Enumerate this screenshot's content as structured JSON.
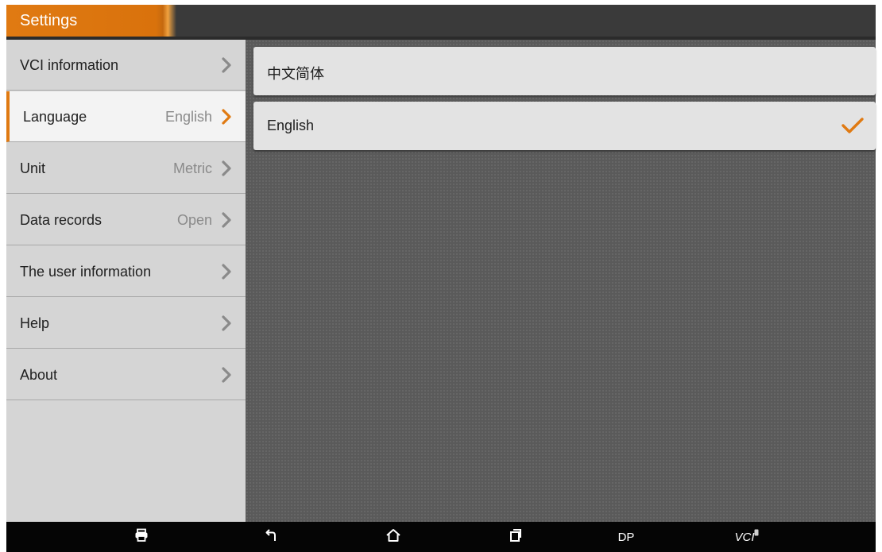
{
  "header": {
    "title": "Settings"
  },
  "colors": {
    "accent": "#e07a12",
    "sidebar_bg": "#d5d5d5",
    "active_bg": "#f3f3f3",
    "content_bg": "#5a5a5a",
    "navbar_bg": "#050505"
  },
  "sidebar": {
    "items": [
      {
        "label": "VCI information",
        "value": ""
      },
      {
        "label": "Language",
        "value": "English"
      },
      {
        "label": "Unit",
        "value": "Metric"
      },
      {
        "label": "Data records",
        "value": "Open"
      },
      {
        "label": "The user information",
        "value": ""
      },
      {
        "label": "Help",
        "value": ""
      },
      {
        "label": "About",
        "value": ""
      }
    ],
    "selected": "Language"
  },
  "languages": {
    "options": [
      {
        "label": "中文简体",
        "selected": false
      },
      {
        "label": "English",
        "selected": true
      }
    ]
  },
  "navbar": {
    "icons": [
      "print-icon",
      "back-icon",
      "home-icon",
      "recent-apps-icon"
    ],
    "dp_label": "DP",
    "vci_label": "VCI"
  }
}
